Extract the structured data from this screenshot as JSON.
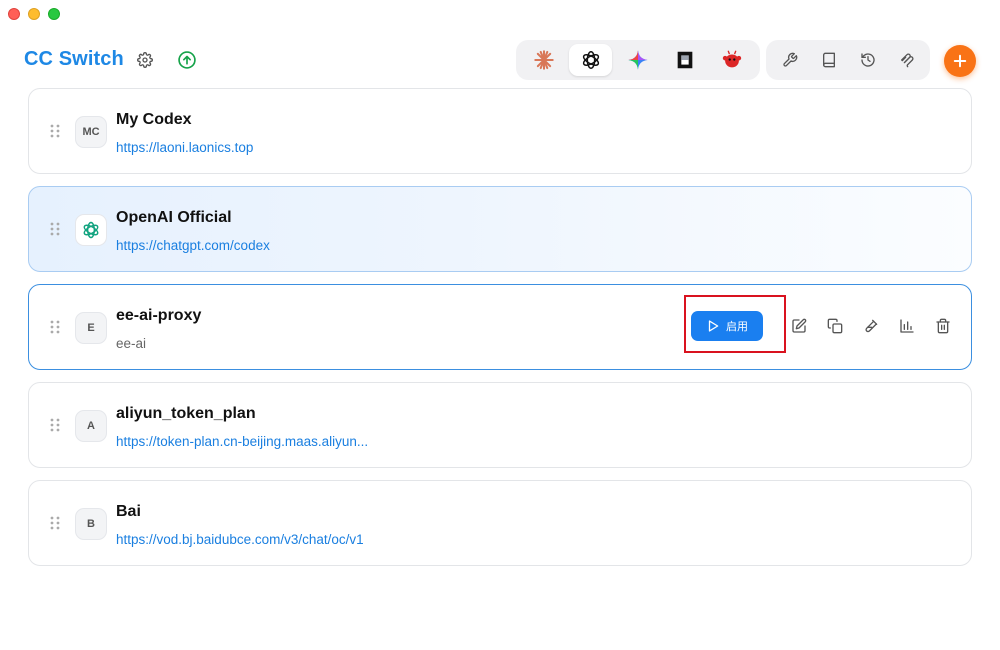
{
  "app": {
    "title": "CC Switch",
    "settings_icon": "gear-icon",
    "update_icon": "upload-circle-icon"
  },
  "apps_group": [
    {
      "name": "claude",
      "icon": "claude-icon",
      "active": false
    },
    {
      "name": "codex",
      "icon": "openai-icon",
      "active": true
    },
    {
      "name": "gemini",
      "icon": "gemini-icon",
      "active": false
    },
    {
      "name": "opencode",
      "icon": "opencode-icon",
      "active": false
    },
    {
      "name": "openclaw",
      "icon": "openclaw-icon",
      "active": false
    }
  ],
  "tools_group": [
    {
      "icon": "wrench-icon"
    },
    {
      "icon": "book-icon"
    },
    {
      "icon": "history-icon"
    },
    {
      "icon": "mcp-icon"
    }
  ],
  "add_button_icon": "plus-icon",
  "providers": [
    {
      "initials": "MC",
      "name": "My Codex",
      "url": "https://laoni.laonics.top",
      "url_style": "link"
    },
    {
      "initials": "",
      "name": "OpenAI Official",
      "url": "https://chatgpt.com/codex",
      "url_style": "link",
      "current": true
    },
    {
      "initials": "E",
      "name": "ee-ai-proxy",
      "url": "ee-ai",
      "url_style": "plain"
    },
    {
      "initials": "A",
      "name": "aliyun_token_plan",
      "url": "https://token-plan.cn-beijing.maas.aliyun...",
      "url_style": "link"
    },
    {
      "initials": "B",
      "name": "Bai",
      "url": "https://vod.bj.baidubce.com/v3/chat/oc/v1",
      "url_style": "link"
    }
  ],
  "actions": {
    "enable_label": "启用",
    "icons": [
      "edit-icon",
      "duplicate-icon",
      "test-icon",
      "usage-chart-icon",
      "delete-icon"
    ]
  },
  "colors": {
    "brand": "#1e88e5",
    "accent_orange": "#f97316",
    "enable_blue": "#1a7ff0",
    "link": "#1a7fe0",
    "highlight": "#d9121f"
  }
}
